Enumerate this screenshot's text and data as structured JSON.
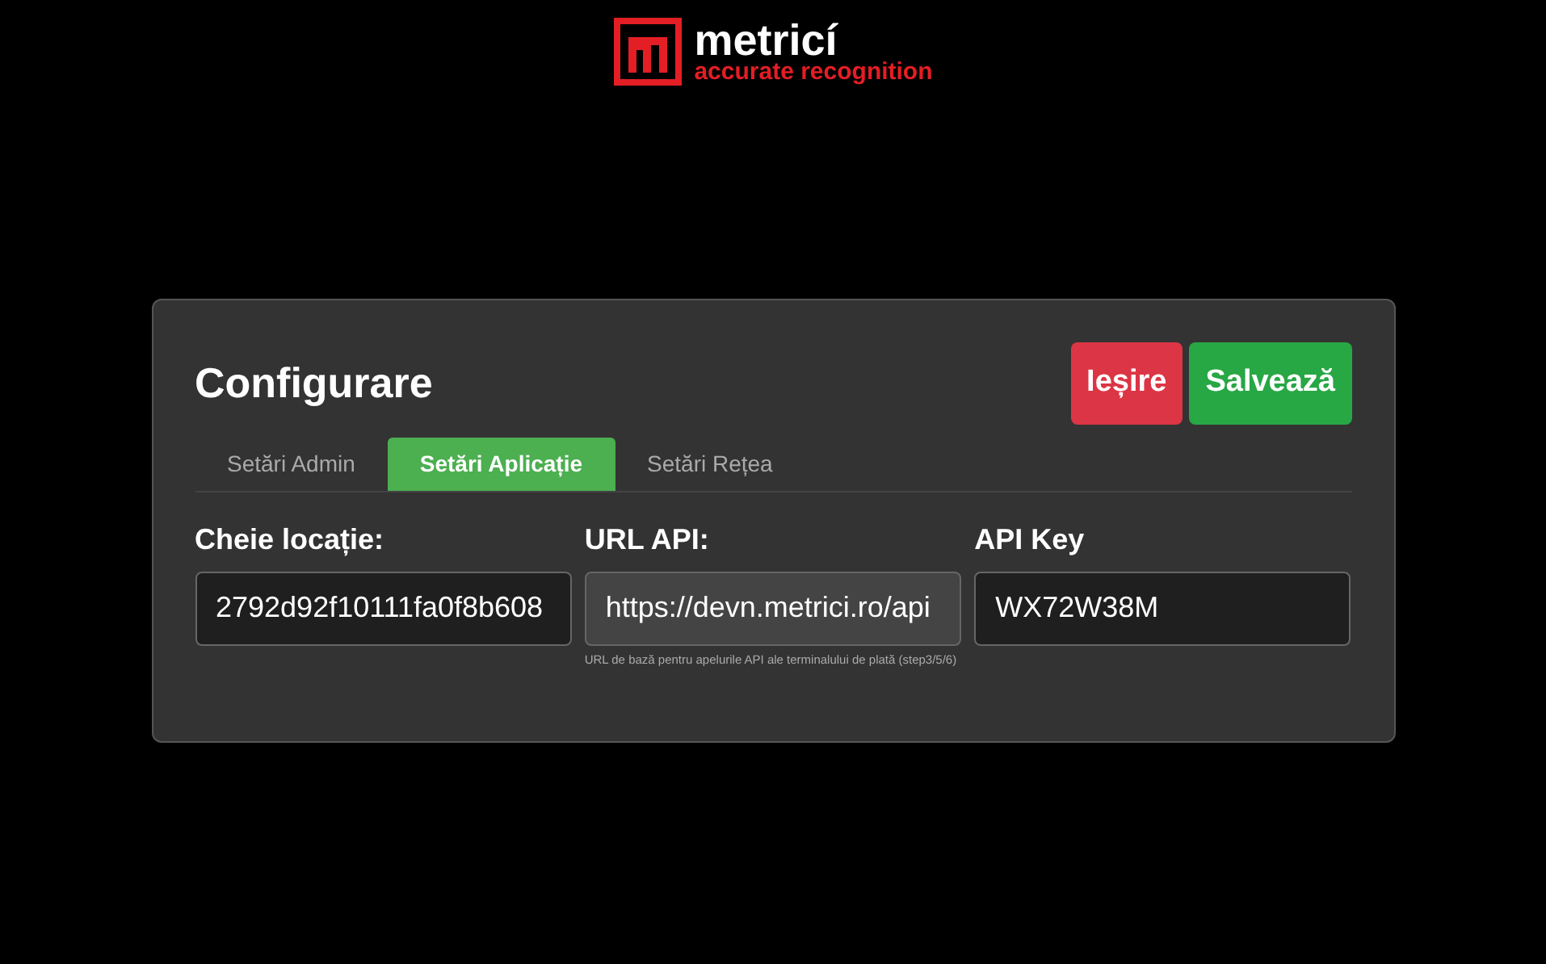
{
  "logo": {
    "name": "metricí",
    "tagline": "accurate recognition"
  },
  "panel": {
    "title": "Configurare",
    "buttons": [
      {
        "label": "Ieșire",
        "kind": "danger"
      },
      {
        "label": "Salvează",
        "kind": "success"
      }
    ],
    "tabs": [
      {
        "label": "Setări Admin",
        "selected": false
      },
      {
        "label": "Setări Aplicație",
        "selected": true
      },
      {
        "label": "Setări Rețea",
        "selected": false
      }
    ],
    "fields": [
      {
        "label": "Cheie locație:",
        "value": "2792d92f10111fa0f8b608",
        "disabled": false
      },
      {
        "label": "URL API:",
        "value": "https://devn.metrici.ro/api",
        "disabled": true,
        "help": "URL de bază pentru apelurile API ale terminalului de plată (step3/5/6)"
      },
      {
        "label": "API Key",
        "value": "WX72W38M",
        "disabled": false
      }
    ]
  }
}
